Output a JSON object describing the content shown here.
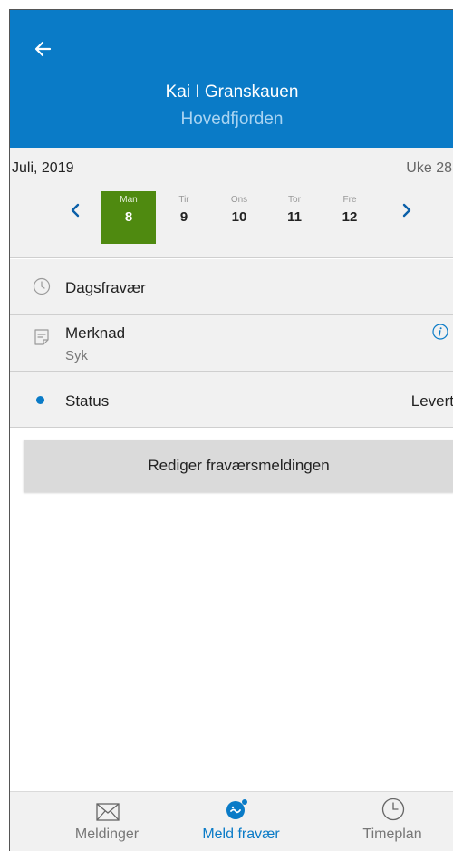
{
  "header": {
    "name": "Kai I Granskauen",
    "school": "Hovedfjorden",
    "color": "#0a7bc7"
  },
  "calendar": {
    "month": "Juli, 2019",
    "week": "Uke 28",
    "days": [
      {
        "name": "Man",
        "num": "8",
        "selected": true
      },
      {
        "name": "Tir",
        "num": "9",
        "selected": false
      },
      {
        "name": "Ons",
        "num": "10",
        "selected": false
      },
      {
        "name": "Tor",
        "num": "11",
        "selected": false
      },
      {
        "name": "Fre",
        "num": "12",
        "selected": false
      }
    ],
    "selected_color": "#4f8a10"
  },
  "details": {
    "absence_type": "Dagsfravær",
    "note_label": "Merknad",
    "note_value": "Syk",
    "status_label": "Status",
    "status_value": "Levert"
  },
  "actions": {
    "edit_label": "Rediger fraværsmeldingen"
  },
  "tabs": [
    {
      "label": "Meldinger",
      "icon": "mail-icon",
      "active": false
    },
    {
      "label": "Meld fravær",
      "icon": "report-absence-icon",
      "active": true
    },
    {
      "label": "Timeplan",
      "icon": "clock-icon",
      "active": false
    }
  ]
}
